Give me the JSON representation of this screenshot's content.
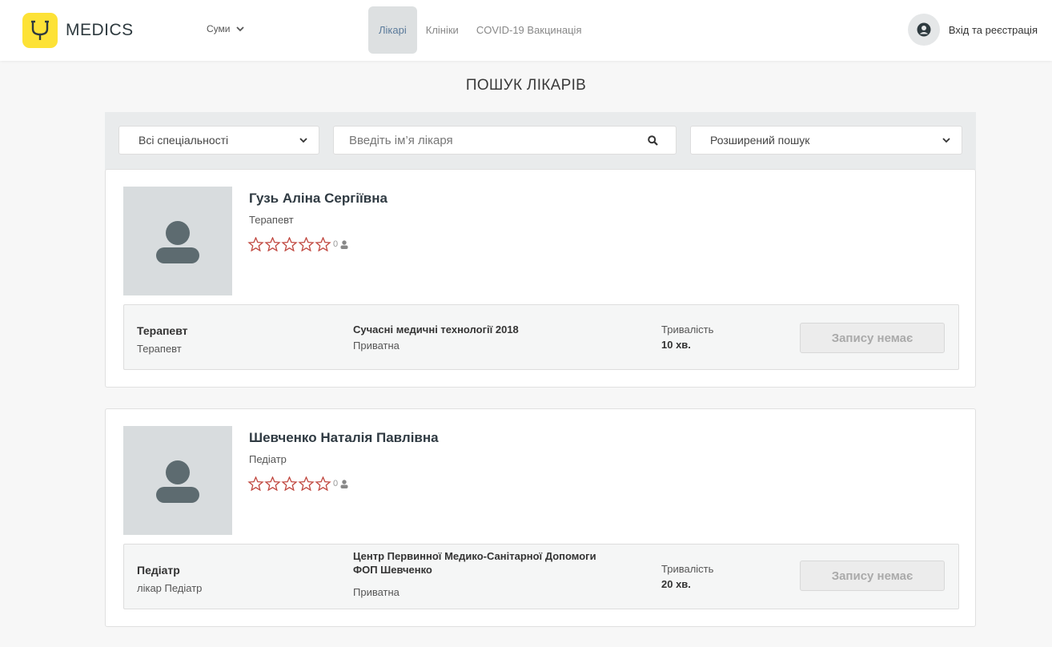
{
  "brand": {
    "name": "MEDICS",
    "accent": "#fde236"
  },
  "header": {
    "city": "Суми",
    "nav": [
      "Лікарі",
      "Клініки",
      "COVID-19 Вакцинація"
    ],
    "login": "Вхід та реєстрація"
  },
  "page_title": "ПОШУК ЛІКАРІВ",
  "search": {
    "specialty": "Всі спеціальності",
    "name_placeholder": "Введіть ім’я лікаря",
    "advanced": "Розширений пошук"
  },
  "doctors": [
    {
      "name": "Гузь Аліна Сергіївна",
      "specialty": "Терапевт",
      "rating_count": "0",
      "service_title": "Терапевт",
      "service_sub": "Терапевт",
      "clinic": "Сучасні медичні технології 2018",
      "clinic_type": "Приватна",
      "duration_label": "Тривалість",
      "duration": "10 хв.",
      "button": "Запису немає"
    },
    {
      "name": "Шевченко Наталія Павлівна",
      "specialty": "Педіатр",
      "rating_count": "0",
      "service_title": "Педіатр",
      "service_sub": "лікар Педіатр",
      "clinic": "Центр Первинної Медико-Санітарної Допомоги ФОП Шевченко",
      "clinic_type": "Приватна",
      "duration_label": "Тривалість",
      "duration": "20 хв.",
      "button": "Запису немає"
    }
  ]
}
